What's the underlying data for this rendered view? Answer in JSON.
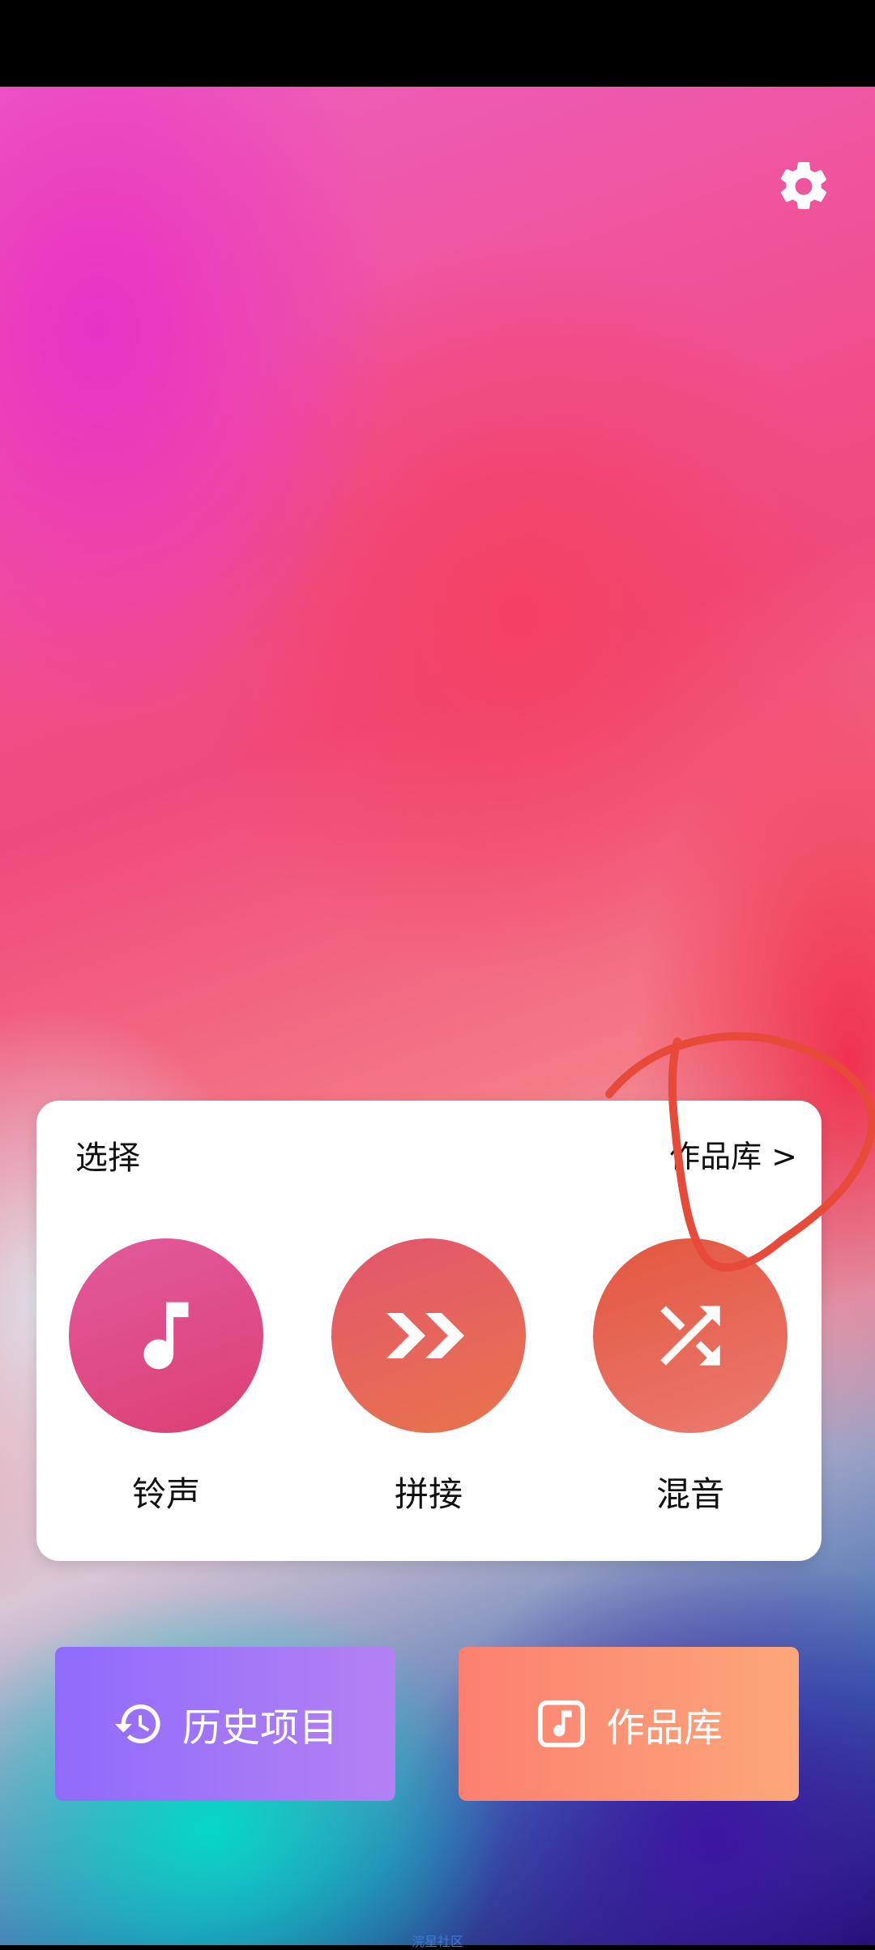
{
  "card": {
    "title": "选择",
    "library_link": "作品库 >"
  },
  "tools": [
    {
      "label": "铃声",
      "icon": "music-note-icon"
    },
    {
      "label": "拼接",
      "icon": "fast-forward-icon"
    },
    {
      "label": "混音",
      "icon": "shuffle-icon"
    }
  ],
  "buttons": {
    "history": "历史项目",
    "works": "作品库"
  },
  "footer": {
    "text": "浣星社区"
  },
  "colors": {
    "history_start": "#8f6bfb",
    "works_start": "#fb8070",
    "annotation": "#e84a3a"
  },
  "icons": {
    "settings": "gear-icon",
    "history": "history-icon",
    "works": "music-file-icon"
  }
}
